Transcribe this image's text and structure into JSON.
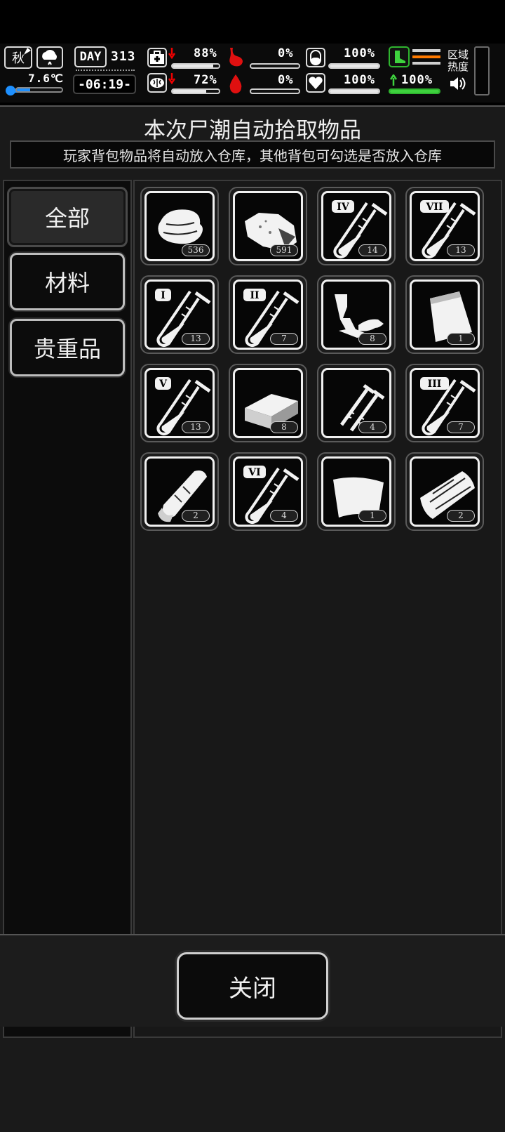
{
  "hud": {
    "season": "秋",
    "temperature": "7.6℃",
    "day_label": "DAY",
    "day_number": "313",
    "time": "-06:19-",
    "stats": {
      "health": "88%",
      "hunger": "0%",
      "energy": "100%",
      "mood": "72%",
      "thirst": "0%",
      "heart": "100%",
      "stamina": "100%"
    },
    "levels": {
      "health": 0.88,
      "hunger": 0.0,
      "energy": 1.0,
      "mood": 0.72,
      "thirst": 0.0,
      "heart": 1.0,
      "stamina": 1.0,
      "temperature": 0.3
    },
    "zone_heat_label": "区域热度"
  },
  "panel": {
    "title": "本次尸潮自动拾取物品",
    "subtitle": "玩家背包物品将自动放入仓库，其他背包可勾选是否放入仓库"
  },
  "tabs": [
    {
      "label": "全部",
      "active": true
    },
    {
      "label": "材料",
      "active": false
    },
    {
      "label": "贵重品",
      "active": false
    }
  ],
  "items": [
    {
      "icon": "cloth-icon",
      "count": "536"
    },
    {
      "icon": "rock-icon",
      "count": "591"
    },
    {
      "icon": "test-tube-icon",
      "roman": "IV",
      "count": "14"
    },
    {
      "icon": "test-tube-icon",
      "roman": "VII",
      "count": "13"
    },
    {
      "icon": "test-tube-icon",
      "roman": "I",
      "count": "13"
    },
    {
      "icon": "test-tube-icon",
      "roman": "II",
      "count": "7"
    },
    {
      "icon": "scrap-parts-icon",
      "count": "8"
    },
    {
      "icon": "bag-icon",
      "count": "1"
    },
    {
      "icon": "test-tube-icon",
      "roman": "V",
      "count": "13"
    },
    {
      "icon": "brick-icon",
      "count": "8"
    },
    {
      "icon": "nails-icon",
      "count": "4"
    },
    {
      "icon": "test-tube-icon",
      "roman": "III",
      "count": "7"
    },
    {
      "icon": "bandage-roll-icon",
      "count": "2"
    },
    {
      "icon": "test-tube-icon",
      "roman": "VI",
      "count": "4"
    },
    {
      "icon": "fabric-sheet-icon",
      "count": "1"
    },
    {
      "icon": "wood-planks-icon",
      "count": "2"
    }
  ],
  "footer": {
    "close_label": "关闭"
  }
}
